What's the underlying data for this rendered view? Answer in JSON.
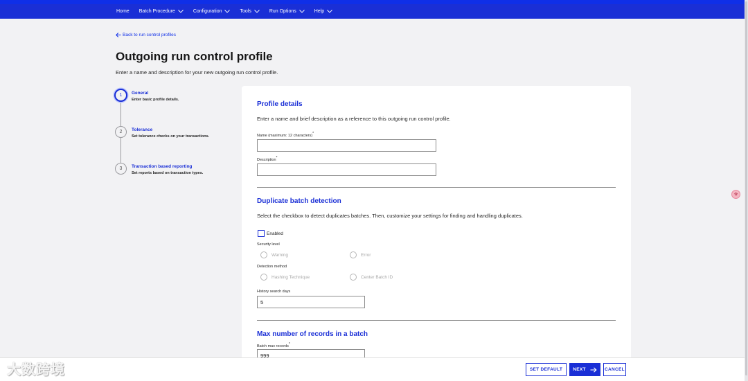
{
  "nav": {
    "items": [
      {
        "label": "Home",
        "dropdown": false
      },
      {
        "label": "Batch Procedure",
        "dropdown": true
      },
      {
        "label": "Configuration",
        "dropdown": true
      },
      {
        "label": "Tools",
        "dropdown": true
      },
      {
        "label": "Run Options",
        "dropdown": true
      },
      {
        "label": "Help",
        "dropdown": true
      }
    ]
  },
  "header": {
    "back_link": "Back to run control profiles",
    "title": "Outgoing run control profile",
    "subtitle": "Enter a name and description for your new outgoing run control profile."
  },
  "steps": [
    {
      "number": "1",
      "title": "General",
      "desc": "Enter basic profile details.",
      "active": true
    },
    {
      "number": "2",
      "title": "Tolerance",
      "desc": "Set tolerance checks on your transactions.",
      "active": false
    },
    {
      "number": "3",
      "title": "Transaction based reporting",
      "desc": "Set reports based on transaction types.",
      "active": false
    }
  ],
  "profile_details": {
    "title": "Profile details",
    "desc": "Enter a name and brief description as a reference to this outgoing run control profile.",
    "name_label": "Name (maximum: 12 characters)",
    "name_value": "",
    "description_label": "Description",
    "description_value": "",
    "required_mark": "*"
  },
  "duplicate": {
    "title": "Duplicate batch detection",
    "desc": "Select the checkbox to detect duplicates batches. Then, customize your settings for finding and handling duplicates.",
    "enabled_label": "Enabled",
    "enabled_checked": false,
    "security_label": "Security level",
    "security_options": [
      "Warning",
      "Error"
    ],
    "method_label": "Detection method",
    "method_options": [
      "Hashing Technique",
      "Center Batch ID"
    ],
    "history_label": "History search days",
    "history_value": "5"
  },
  "max_records": {
    "title": "Max number of records in a batch",
    "label": "Batch max records",
    "value": "999",
    "required_mark": "*"
  },
  "footer": {
    "set_default": "SET DEFAULT",
    "next": "NEXT",
    "cancel": "CANCEL"
  },
  "watermark": "大数跨境",
  "colors": {
    "primary": "#1a2fd6",
    "topbar": "#0f2fe8",
    "background": "#f2f2f4"
  }
}
